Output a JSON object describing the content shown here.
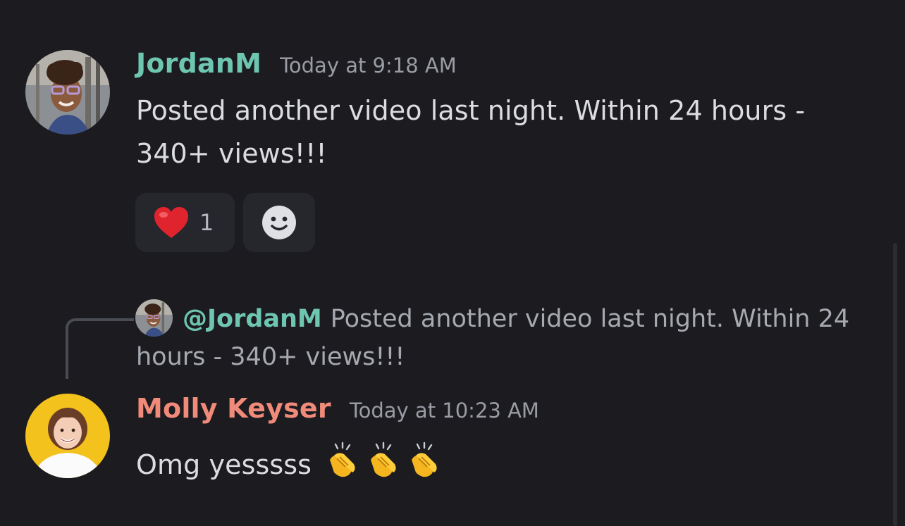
{
  "messages": [
    {
      "username": "JordanM",
      "timestamp": "Today at 9:18 AM",
      "text": "Posted another video last night. Within 24 hours - 340+ views!!!",
      "reactions": [
        {
          "icon": "heart-emoji",
          "count": "1"
        }
      ],
      "add_reaction_icon": "smiley-face-icon"
    },
    {
      "reply": {
        "mention": "@JordanM",
        "preview": "Posted another video last night. Within 24 hours - 340+ views!!!"
      },
      "username": "Molly Keyser",
      "timestamp": "Today at 10:23 AM",
      "text": "Omg yesssss",
      "emojis": [
        "clapping-hands-emoji",
        "clapping-hands-emoji",
        "clapping-hands-emoji"
      ]
    }
  ],
  "colors": {
    "background": "#1b1b20",
    "jordan_name": "#6ec6b0",
    "molly_name": "#f08a79",
    "reaction_bg": "#26262d",
    "timestamp": "#9a9ca4"
  }
}
